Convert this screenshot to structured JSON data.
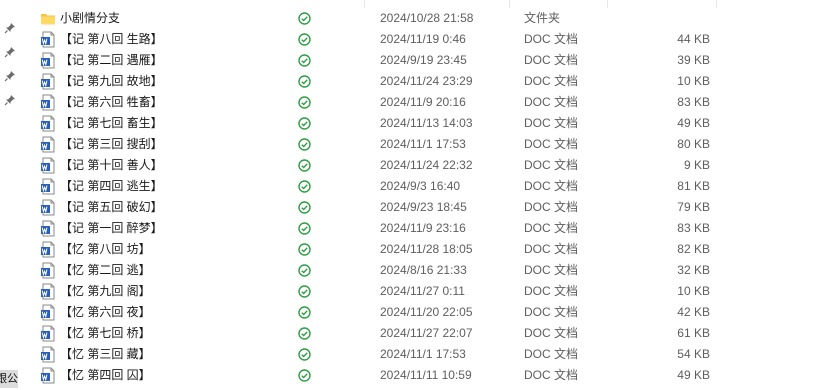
{
  "sidebar": {
    "pins": [
      "pin-icon",
      "pin-icon",
      "pin-icon",
      "pin-icon"
    ],
    "clipped_label": "跟公"
  },
  "colors": {
    "status_green": "#2f9e44",
    "folder_yellow": "#f6c342",
    "word_blue": "#2b5eb7"
  },
  "files": [
    {
      "name": "小剧情分支",
      "icon": "folder-icon",
      "date": "2024/10/28 21:58",
      "type": "文件夹",
      "size": ""
    },
    {
      "name": "【记 第八回 生路】",
      "icon": "word-doc-icon",
      "date": "2024/11/19 0:46",
      "type": "DOC 文档",
      "size": "44 KB"
    },
    {
      "name": "【记 第二回 遇雁】",
      "icon": "word-doc-icon",
      "date": "2024/9/19 23:45",
      "type": "DOC 文档",
      "size": "39 KB"
    },
    {
      "name": "【记 第九回 故地】",
      "icon": "word-doc-icon",
      "date": "2024/11/24 23:29",
      "type": "DOC 文档",
      "size": "10 KB"
    },
    {
      "name": "【记 第六回 牲畜】",
      "icon": "word-doc-icon",
      "date": "2024/11/9 20:16",
      "type": "DOC 文档",
      "size": "83 KB"
    },
    {
      "name": "【记 第七回 畜生】",
      "icon": "word-doc-icon",
      "date": "2024/11/13 14:03",
      "type": "DOC 文档",
      "size": "49 KB"
    },
    {
      "name": "【记 第三回 搜刮】",
      "icon": "word-doc-icon",
      "date": "2024/11/1 17:53",
      "type": "DOC 文档",
      "size": "80 KB"
    },
    {
      "name": "【记 第十回 善人】",
      "icon": "word-doc-icon",
      "date": "2024/11/24 22:32",
      "type": "DOC 文档",
      "size": "9 KB"
    },
    {
      "name": "【记 第四回 逃生】",
      "icon": "word-doc-icon",
      "date": "2024/9/3 16:40",
      "type": "DOC 文档",
      "size": "81 KB"
    },
    {
      "name": "【记 第五回 破幻】",
      "icon": "word-doc-icon",
      "date": "2024/9/23 18:45",
      "type": "DOC 文档",
      "size": "79 KB"
    },
    {
      "name": "【记 第一回 醉梦】",
      "icon": "word-doc-icon",
      "date": "2024/11/9 23:16",
      "type": "DOC 文档",
      "size": "83 KB"
    },
    {
      "name": "【忆 第八回 坊】",
      "icon": "word-doc-icon",
      "date": "2024/11/28 18:05",
      "type": "DOC 文档",
      "size": "82 KB"
    },
    {
      "name": "【忆 第二回 逃】",
      "icon": "word-doc-icon",
      "date": "2024/8/16 21:33",
      "type": "DOC 文档",
      "size": "32 KB"
    },
    {
      "name": "【忆 第九回 阁】",
      "icon": "word-doc-icon",
      "date": "2024/11/27 0:11",
      "type": "DOC 文档",
      "size": "10 KB"
    },
    {
      "name": "【忆 第六回 夜】",
      "icon": "word-doc-icon",
      "date": "2024/11/20 22:05",
      "type": "DOC 文档",
      "size": "42 KB"
    },
    {
      "name": "【忆 第七回 桥】",
      "icon": "word-doc-icon",
      "date": "2024/11/27 22:07",
      "type": "DOC 文档",
      "size": "61 KB"
    },
    {
      "name": "【忆 第三回 藏】",
      "icon": "word-doc-icon",
      "date": "2024/11/1 17:53",
      "type": "DOC 文档",
      "size": "54 KB"
    },
    {
      "name": "【忆 第四回 囚】",
      "icon": "word-doc-icon",
      "date": "2024/11/11 10:59",
      "type": "DOC 文档",
      "size": "49 KB"
    }
  ]
}
